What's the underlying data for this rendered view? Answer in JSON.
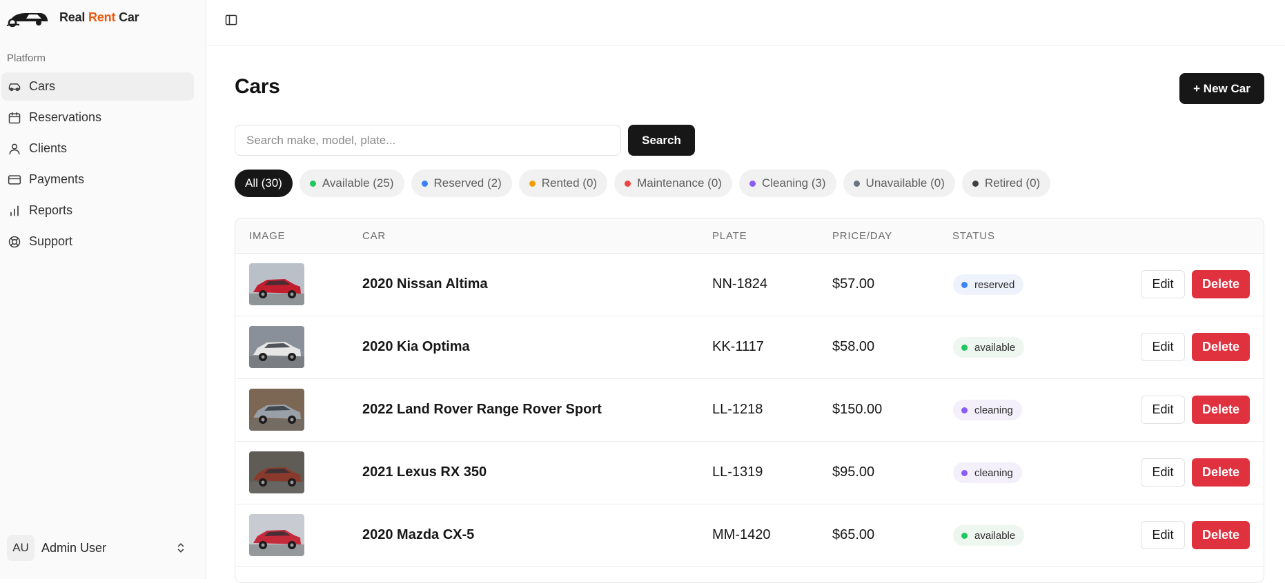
{
  "brand": {
    "name_part1": "Real",
    "name_accent": "Rent",
    "name_part2": "Car"
  },
  "sidebar": {
    "group_label": "Platform",
    "items": [
      {
        "label": "Cars",
        "icon": "car-icon",
        "active": true
      },
      {
        "label": "Reservations",
        "icon": "calendar-icon",
        "active": false
      },
      {
        "label": "Clients",
        "icon": "user-icon",
        "active": false
      },
      {
        "label": "Payments",
        "icon": "credit-card-icon",
        "active": false
      },
      {
        "label": "Reports",
        "icon": "bar-chart-icon",
        "active": false
      },
      {
        "label": "Support",
        "icon": "lifebuoy-icon",
        "active": false
      }
    ],
    "user": {
      "initials": "AU",
      "name": "Admin User"
    }
  },
  "page": {
    "title": "Cars",
    "new_button": "+ New Car",
    "search": {
      "placeholder": "Search make, model, plate...",
      "value": "",
      "button": "Search"
    }
  },
  "filters": [
    {
      "label": "All (30)",
      "active": true,
      "color": ""
    },
    {
      "label": "Available (25)",
      "active": false,
      "color": "#22c55e"
    },
    {
      "label": "Reserved (2)",
      "active": false,
      "color": "#3b82f6"
    },
    {
      "label": "Rented (0)",
      "active": false,
      "color": "#f59e0b"
    },
    {
      "label": "Maintenance (0)",
      "active": false,
      "color": "#ef4444"
    },
    {
      "label": "Cleaning (3)",
      "active": false,
      "color": "#8b5cf6"
    },
    {
      "label": "Unavailable (0)",
      "active": false,
      "color": "#6b7280"
    },
    {
      "label": "Retired (0)",
      "active": false,
      "color": "#404040"
    }
  ],
  "table": {
    "columns": [
      "IMAGE",
      "CAR",
      "PLATE",
      "PRICE/DAY",
      "STATUS"
    ],
    "edit_label": "Edit",
    "delete_label": "Delete",
    "rows": [
      {
        "car": "2020 Nissan Altima",
        "plate": "NN-1824",
        "price": "$57.00",
        "status": "reserved",
        "status_color": "#3b82f6",
        "status_bg": "#eef2fb",
        "thumb_color": "#c21e2e",
        "thumb_bg": "#b9c0c8"
      },
      {
        "car": "2020 Kia Optima",
        "plate": "KK-1117",
        "price": "$58.00",
        "status": "available",
        "status_color": "#22c55e",
        "status_bg": "#eef6f0",
        "thumb_color": "#e6e6e6",
        "thumb_bg": "#8a9099"
      },
      {
        "car": "2022 Land Rover Range Rover Sport",
        "plate": "LL-1218",
        "price": "$150.00",
        "status": "cleaning",
        "status_color": "#8b5cf6",
        "status_bg": "#f3effb",
        "thumb_color": "#9aa0a8",
        "thumb_bg": "#7c6654"
      },
      {
        "car": "2021 Lexus RX 350",
        "plate": "LL-1319",
        "price": "$95.00",
        "status": "cleaning",
        "status_color": "#8b5cf6",
        "status_bg": "#f3effb",
        "thumb_color": "#8a3a2c",
        "thumb_bg": "#5f5c55"
      },
      {
        "car": "2020 Mazda CX-5",
        "plate": "MM-1420",
        "price": "$65.00",
        "status": "available",
        "status_color": "#22c55e",
        "status_bg": "#eef6f0",
        "thumb_color": "#c52a3b",
        "thumb_bg": "#c8ccd2"
      }
    ]
  }
}
